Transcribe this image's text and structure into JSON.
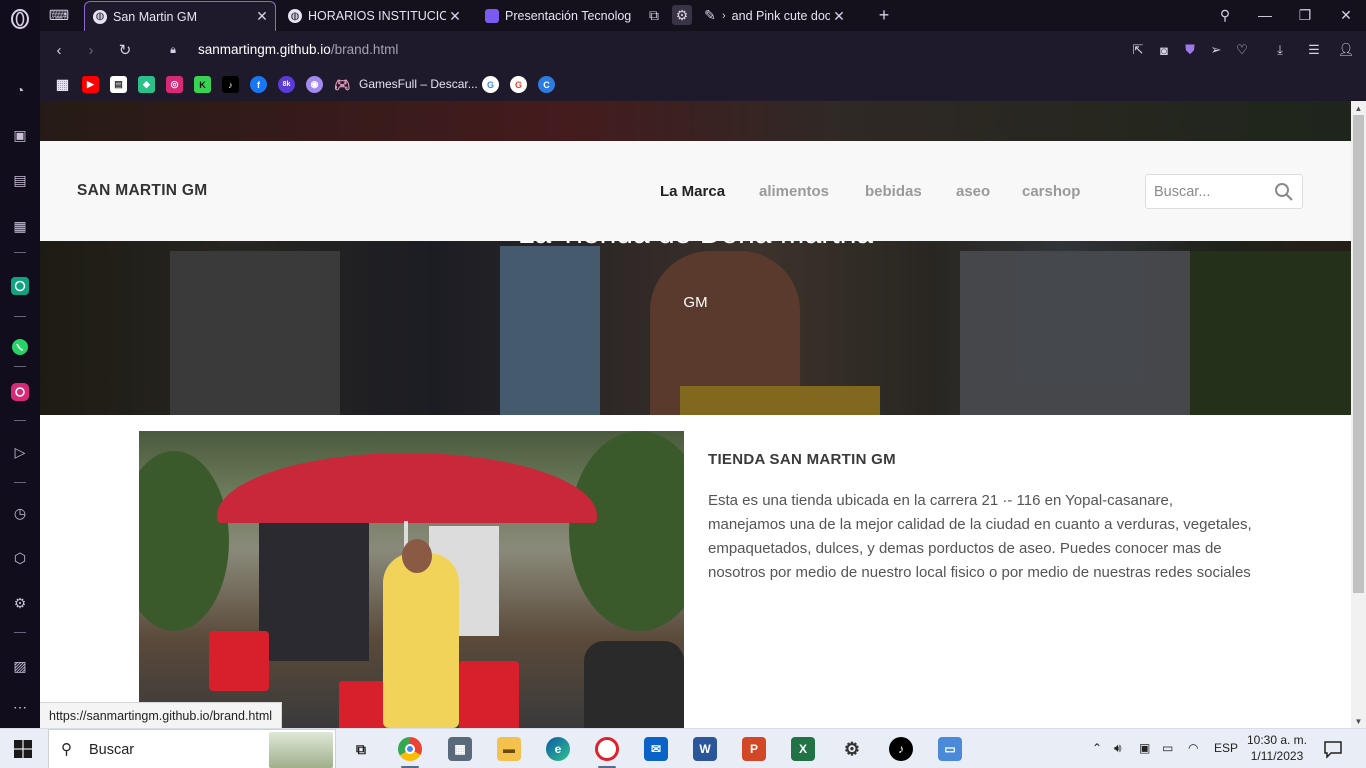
{
  "browser": {
    "tabs": [
      {
        "title": "San Martin GM",
        "active": true
      },
      {
        "title": "HORARIOS INSTITUCIONALES",
        "active": false
      },
      {
        "title": "Presentación Tecnología ||",
        "active": false
      },
      {
        "title": "and Pink cute doodle",
        "active": false
      }
    ],
    "url_host": "sanmartingm.github.io",
    "url_path": "/brand.html",
    "bookmark_label": "GamesFull – Descar..."
  },
  "site": {
    "brand": "SAN MARTIN GM",
    "nav": [
      {
        "label": "La Marca",
        "active": true
      },
      {
        "label": "alimentos",
        "active": false
      },
      {
        "label": "bebidas",
        "active": false
      },
      {
        "label": "aseo",
        "active": false
      },
      {
        "label": "carshop",
        "active": false
      }
    ],
    "search_placeholder": "Buscar...",
    "hero_title": "La Tienda de Doña Martha",
    "hero_subtitle": "GM",
    "section_title": "TIENDA SAN MARTIN GM",
    "section_text": "Esta es una tienda ubicada en la carrera 21 ·- 116 en Yopal-casanare, manejamos una de la mejor calidad de la ciudad en cuanto a verduras, vegetales, empaquetados, dulces, y demas porductos de aseo. Puedes conocer mas de nosotros por medio de nuestro local fisico o por medio de nuestras redes sociales"
  },
  "status_bar_url": "https://sanmartingm.github.io/brand.html",
  "taskbar": {
    "search_label": "Buscar",
    "language": "ESP",
    "time": "10:30 a. m.",
    "date": "1/11/2023"
  },
  "colors": {
    "accent": "#8a6ad0",
    "nav_active": "#222222",
    "nav_inactive": "#9a9a9a"
  }
}
